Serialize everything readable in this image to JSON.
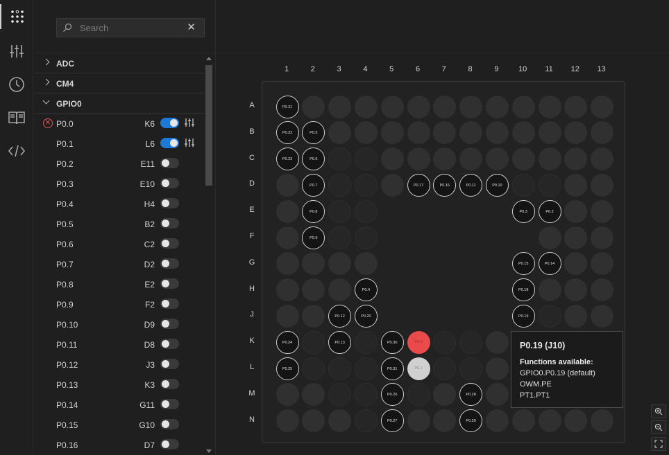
{
  "activity_bar": {
    "items": [
      {
        "name": "pinmux-grid-icon",
        "active": true
      },
      {
        "name": "sliders-icon",
        "active": false
      },
      {
        "name": "clock-icon",
        "active": false
      },
      {
        "name": "book-icon",
        "active": false
      },
      {
        "name": "code-icon",
        "active": false
      }
    ]
  },
  "search": {
    "placeholder": "Search",
    "clear_symbol": "✕"
  },
  "tree": {
    "groups": [
      {
        "label": "ADC",
        "expanded": false
      },
      {
        "label": "CM4",
        "expanded": false
      },
      {
        "label": "GPIO0",
        "expanded": true
      }
    ],
    "pins": [
      {
        "name": "P0.0",
        "ball": "K6",
        "enabled": true,
        "error": true,
        "configurable": true
      },
      {
        "name": "P0.1",
        "ball": "L6",
        "enabled": true,
        "error": false,
        "configurable": true
      },
      {
        "name": "P0.2",
        "ball": "E11",
        "enabled": false
      },
      {
        "name": "P0.3",
        "ball": "E10",
        "enabled": false
      },
      {
        "name": "P0.4",
        "ball": "H4",
        "enabled": false
      },
      {
        "name": "P0.5",
        "ball": "B2",
        "enabled": false
      },
      {
        "name": "P0.6",
        "ball": "C2",
        "enabled": false
      },
      {
        "name": "P0.7",
        "ball": "D2",
        "enabled": false
      },
      {
        "name": "P0.8",
        "ball": "E2",
        "enabled": false
      },
      {
        "name": "P0.9",
        "ball": "F2",
        "enabled": false
      },
      {
        "name": "P0.10",
        "ball": "D9",
        "enabled": false
      },
      {
        "name": "P0.11",
        "ball": "D8",
        "enabled": false
      },
      {
        "name": "P0.12",
        "ball": "J3",
        "enabled": false
      },
      {
        "name": "P0.13",
        "ball": "K3",
        "enabled": false
      },
      {
        "name": "P0.14",
        "ball": "G11",
        "enabled": false
      },
      {
        "name": "P0.15",
        "ball": "G10",
        "enabled": false
      },
      {
        "name": "P0.16",
        "ball": "D7",
        "enabled": false
      }
    ]
  },
  "package": {
    "columns": [
      "1",
      "2",
      "3",
      "4",
      "5",
      "6",
      "7",
      "8",
      "9",
      "10",
      "11",
      "12",
      "13"
    ],
    "rows": [
      "A",
      "B",
      "C",
      "D",
      "E",
      "F",
      "G",
      "H",
      "J",
      "K",
      "L",
      "M",
      "N"
    ],
    "empty": [
      "E5",
      "E6",
      "E7",
      "E8",
      "E9",
      "F5",
      "F6",
      "F7",
      "F8",
      "F9",
      "F10",
      "G5",
      "G6",
      "G7",
      "G8",
      "G9",
      "H5",
      "H6",
      "H7",
      "H8",
      "H9",
      "J5",
      "J6",
      "J7",
      "J8",
      "J9"
    ],
    "dim": [
      "C3",
      "C4",
      "D3",
      "D4",
      "D10",
      "D11",
      "E3",
      "E4",
      "F3",
      "F4",
      "J11",
      "K2",
      "K4",
      "K7",
      "K8",
      "L2",
      "L3",
      "L4",
      "L7",
      "L8",
      "M3",
      "M4",
      "M6",
      "N4"
    ],
    "gpio_pins": {
      "A1": "P0.21",
      "B1": "P0.22",
      "B2": "P0.5",
      "C1": "P0.23",
      "C2": "P0.6",
      "D2": "P0.7",
      "D6": "P0.17",
      "D7": "P0.16",
      "D8": "P0.11",
      "D9": "P0.10",
      "E2": "P0.8",
      "E10": "P0.3",
      "E11": "P0.2",
      "F2": "P0.9",
      "G10": "P0.15",
      "G11": "P0.14",
      "H4": "P0.4",
      "H10": "P0.18",
      "J3": "P0.12",
      "J4": "P0.20",
      "J10": "P0.19",
      "K1": "P0.24",
      "K3": "P0.13",
      "K5": "P0.30",
      "L1": "P0.25",
      "L5": "P0.31",
      "M5": "P0.26",
      "M8": "P0.28",
      "N5": "P0.27",
      "N8": "P0.29"
    },
    "selected": {
      "ball": "K6",
      "label": "P0.0"
    },
    "hovered": {
      "ball": "L6",
      "label": "P0.1"
    }
  },
  "tooltip": {
    "title": "P0.19 (J10)",
    "subtitle": "Functions available:",
    "functions": [
      "GPIO0.P0.19 (default)",
      "OWM.PE",
      "PT1.PT1"
    ]
  },
  "zoom_controls": [
    {
      "name": "zoom-in-icon"
    },
    {
      "name": "zoom-out-icon"
    },
    {
      "name": "fit-screen-icon"
    }
  ],
  "colors": {
    "accent": "#1e79d6",
    "selected_pin": "#ea4a4a",
    "error": "#e05555",
    "background": "#1f1f1f"
  }
}
